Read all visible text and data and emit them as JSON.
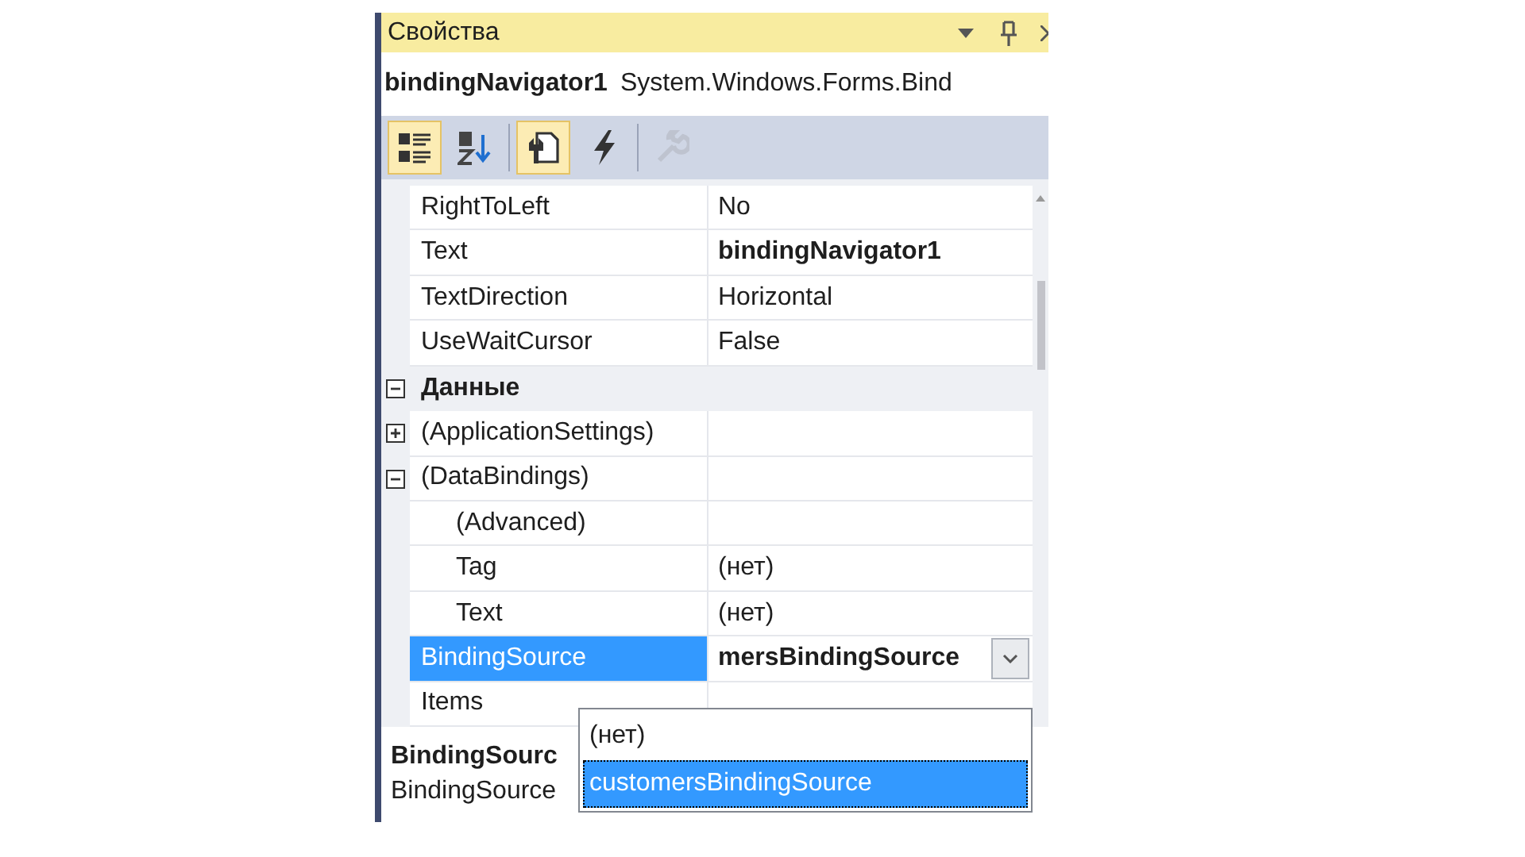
{
  "window": {
    "title": "Свойства"
  },
  "object": {
    "name": "bindingNavigator1",
    "type": "System.Windows.Forms.Bind"
  },
  "toolbar": [
    {
      "kind": "categorized",
      "selected": true,
      "disabled": false
    },
    {
      "kind": "alphabetical",
      "selected": false,
      "disabled": false
    },
    {
      "kind": "separator"
    },
    {
      "kind": "properties",
      "selected": true,
      "disabled": false
    },
    {
      "kind": "events",
      "selected": false,
      "disabled": false
    },
    {
      "kind": "separator"
    },
    {
      "kind": "pages",
      "selected": false,
      "disabled": true
    }
  ],
  "grid": [
    {
      "kind": "property",
      "label": "RightToLeft",
      "value": "No",
      "modified": false,
      "selected": false
    },
    {
      "kind": "property",
      "label": "Text",
      "value": "bindingNavigator1",
      "modified": true,
      "selected": false
    },
    {
      "kind": "property",
      "label": "TextDirection",
      "value": "Horizontal",
      "modified": false,
      "selected": false
    },
    {
      "kind": "property",
      "label": "UseWaitCursor",
      "value": "False",
      "modified": false,
      "selected": false
    },
    {
      "kind": "category",
      "label": "Данные",
      "expanded": true,
      "children": [
        {
          "kind": "property",
          "label": "(ApplicationSettings)",
          "expanded": false,
          "selected": false
        },
        {
          "kind": "property",
          "label": "(DataBindings)",
          "expanded": true,
          "selected": false,
          "children": [
            {
              "kind": "property",
              "label": "(Advanced)",
              "selected": false
            },
            {
              "kind": "property",
              "label": "Tag",
              "value": "(нет)",
              "selected": false,
              "modified": false
            },
            {
              "kind": "property",
              "label": "Text",
              "value": "(нет)",
              "selected": false,
              "modified": false
            }
          ]
        },
        {
          "kind": "property",
          "label": "BindingSource",
          "value": "mersBindingSource",
          "selected": true,
          "modified": true,
          "dropdown": true
        },
        {
          "kind": "property",
          "label": "Items",
          "selected": false
        }
      ]
    }
  ],
  "dropdown": {
    "options": [
      {
        "label": "(нет)",
        "selected": false
      },
      {
        "label": "customersBindingSource",
        "selected": true
      }
    ]
  },
  "description": {
    "title": "BindingSourc",
    "text": "BindingSource"
  }
}
